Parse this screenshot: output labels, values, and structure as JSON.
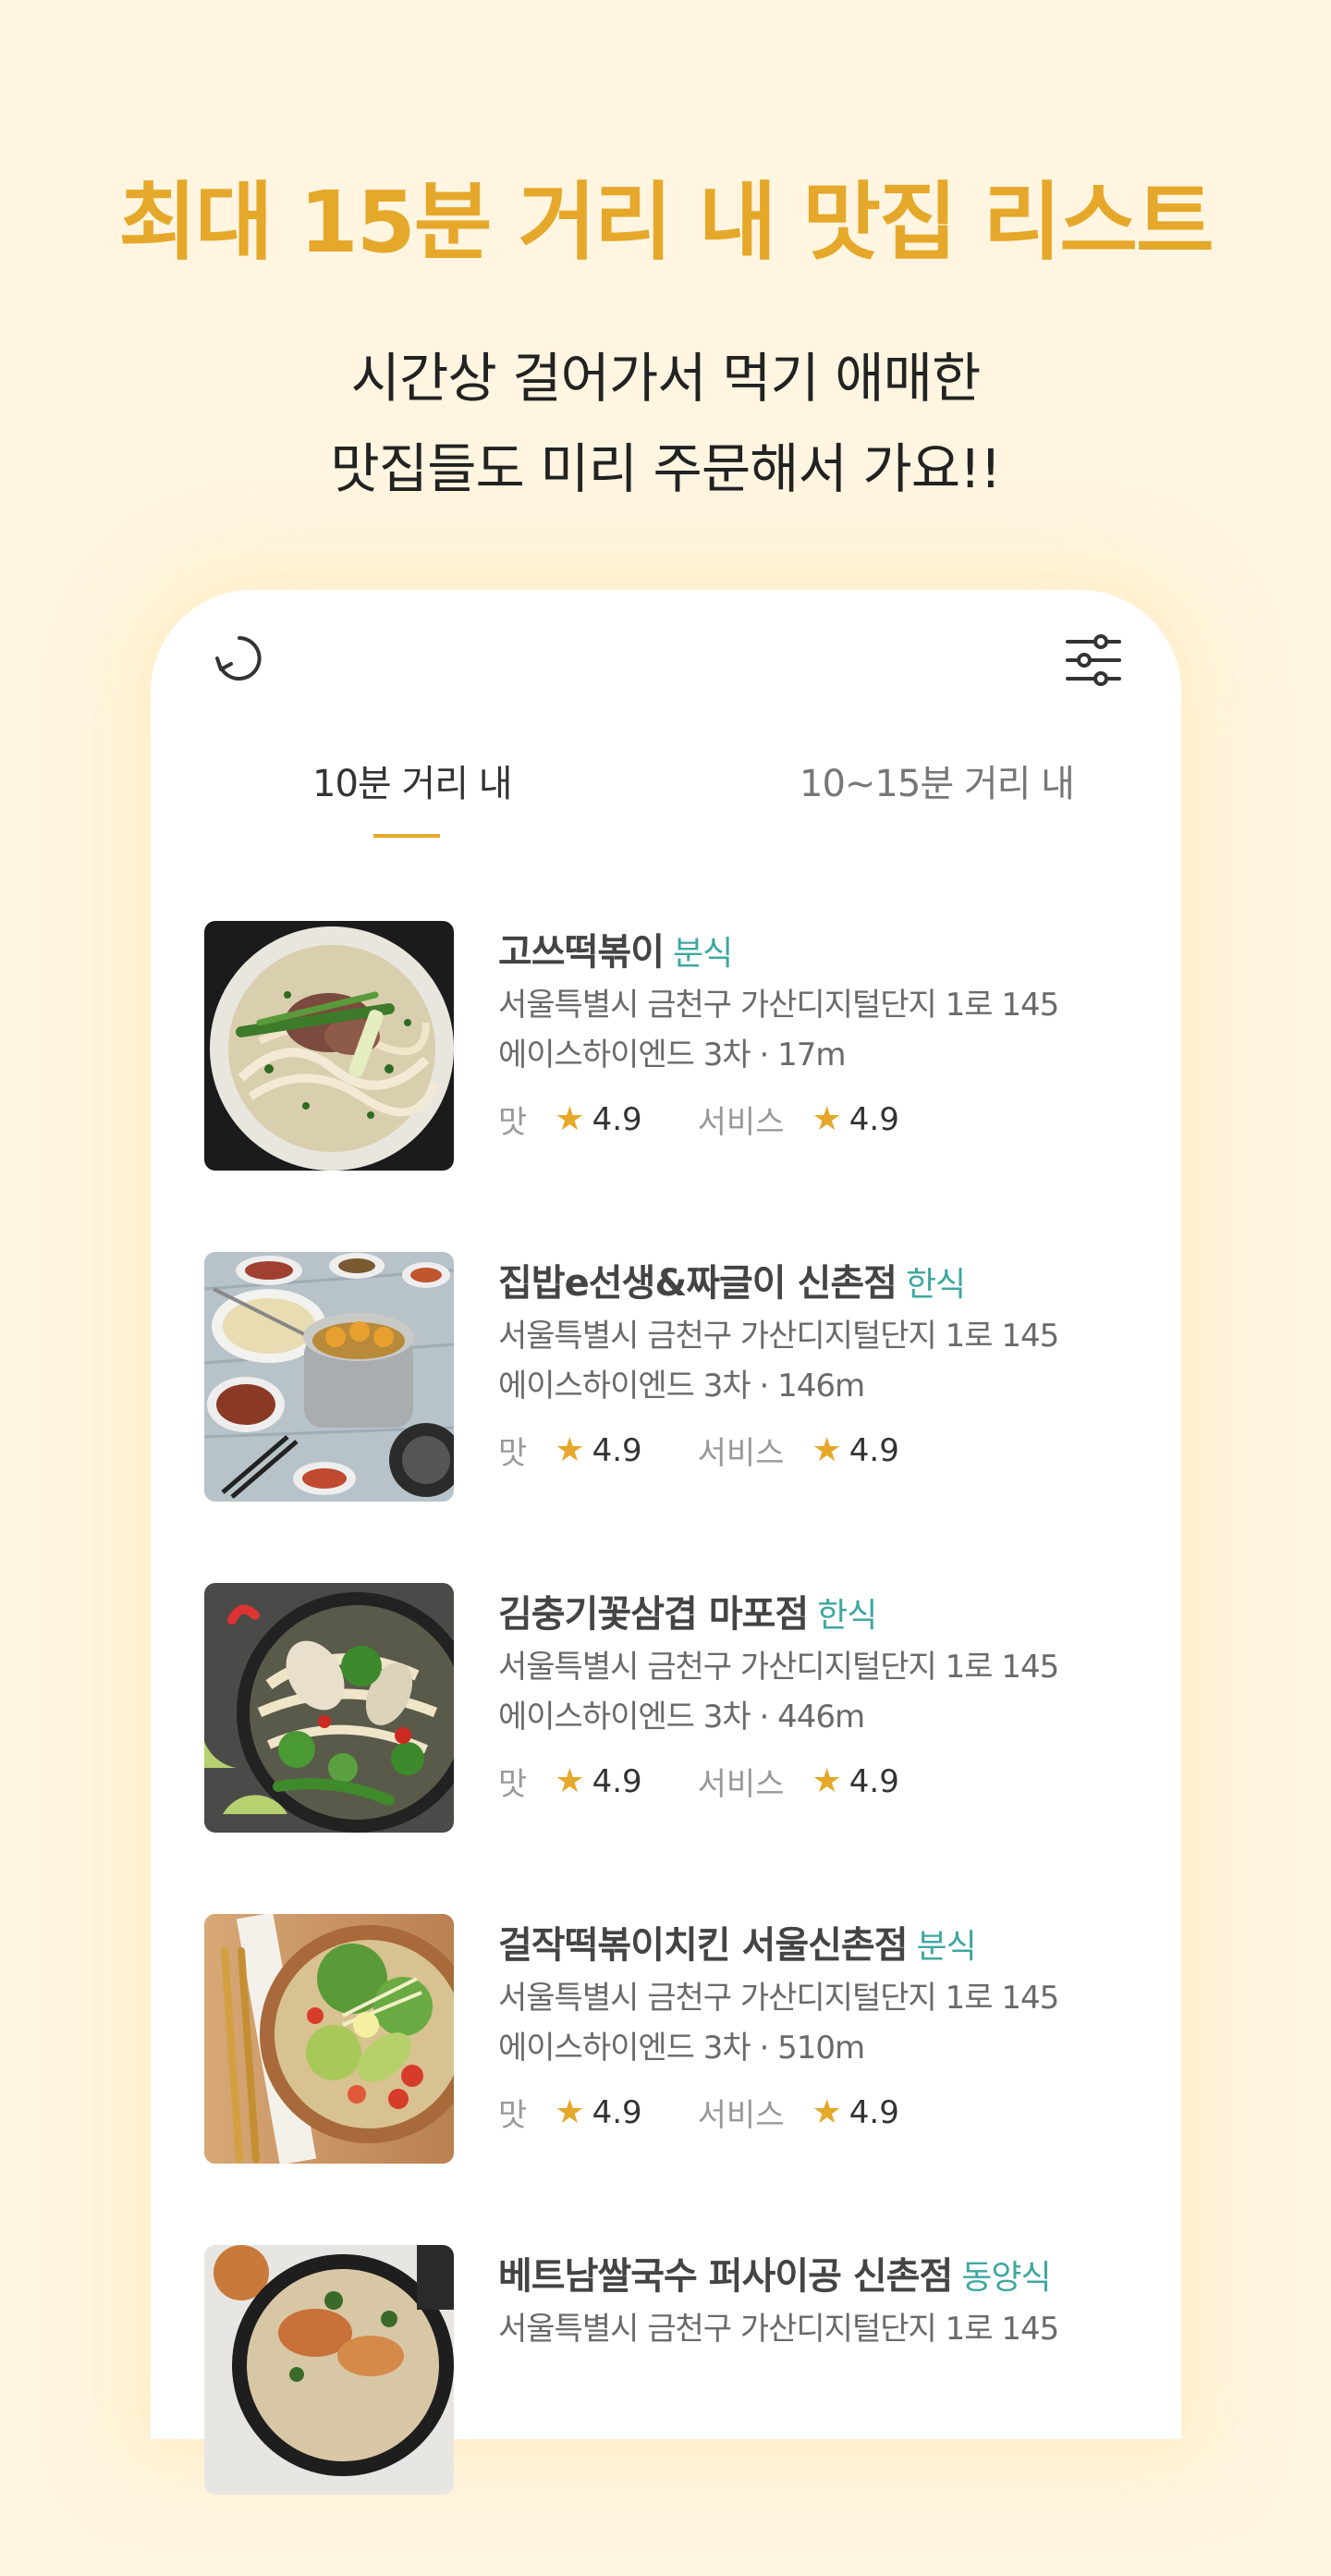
{
  "headline": "최대 15분 거리 내 맛집 리스트",
  "subtitle": {
    "line1": "시간상 걸어가서 먹기 애매한",
    "line2": "맛집들도 미리 주문해서 가요!!"
  },
  "toolbar": {
    "refresh_icon": "refresh-icon",
    "filter_icon": "sliders-filter-icon"
  },
  "tabs": [
    {
      "label": "10분 거리 내",
      "active": true
    },
    {
      "label": "10~15분 거리 내",
      "active": false
    }
  ],
  "colors": {
    "background": "#FFF5E0",
    "accent": "#E5A82A",
    "category": "#3FA7A0"
  },
  "rating_labels": {
    "taste": "맛",
    "service": "서비스"
  },
  "restaurants": [
    {
      "name": "고쓰떡볶이",
      "category": "분식",
      "address": "서울특별시 금천구 가산디지털단지 1로 145",
      "building": "에이스하이엔드 3차",
      "distance": "17m",
      "taste": "4.9",
      "service": "4.9",
      "image": "pho-noodle-bowl"
    },
    {
      "name": "집밥e선생&짜글이 신촌점",
      "category": "한식",
      "address": "서울특별시 금천구 가산디지털단지 1로 145",
      "building": "에이스하이엔드 3차",
      "distance": "146m",
      "taste": "4.9",
      "service": "4.9",
      "image": "korean-table-spread"
    },
    {
      "name": "김충기꽃삼겹 마포점",
      "category": "한식",
      "address": "서울특별시 금천구 가산디지털단지 1로 145",
      "building": "에이스하이엔드 3차",
      "distance": "446m",
      "taste": "4.9",
      "service": "4.9",
      "image": "noodle-stirfry-pan"
    },
    {
      "name": "걸작떡볶이치킨 서울신촌점",
      "category": "분식",
      "address": "서울특별시 금천구 가산디지털단지 1로 145",
      "building": "에이스하이엔드 3차",
      "distance": "510m",
      "taste": "4.9",
      "service": "4.9",
      "image": "salad-bowl"
    },
    {
      "name": "베트남쌀국수 퍼사이공 신촌점",
      "category": "동양식",
      "address": "서울특별시 금천구 가산디지털단지 1로 145",
      "building": "",
      "distance": "",
      "taste": "",
      "service": "",
      "image": "skillet-dish"
    }
  ]
}
